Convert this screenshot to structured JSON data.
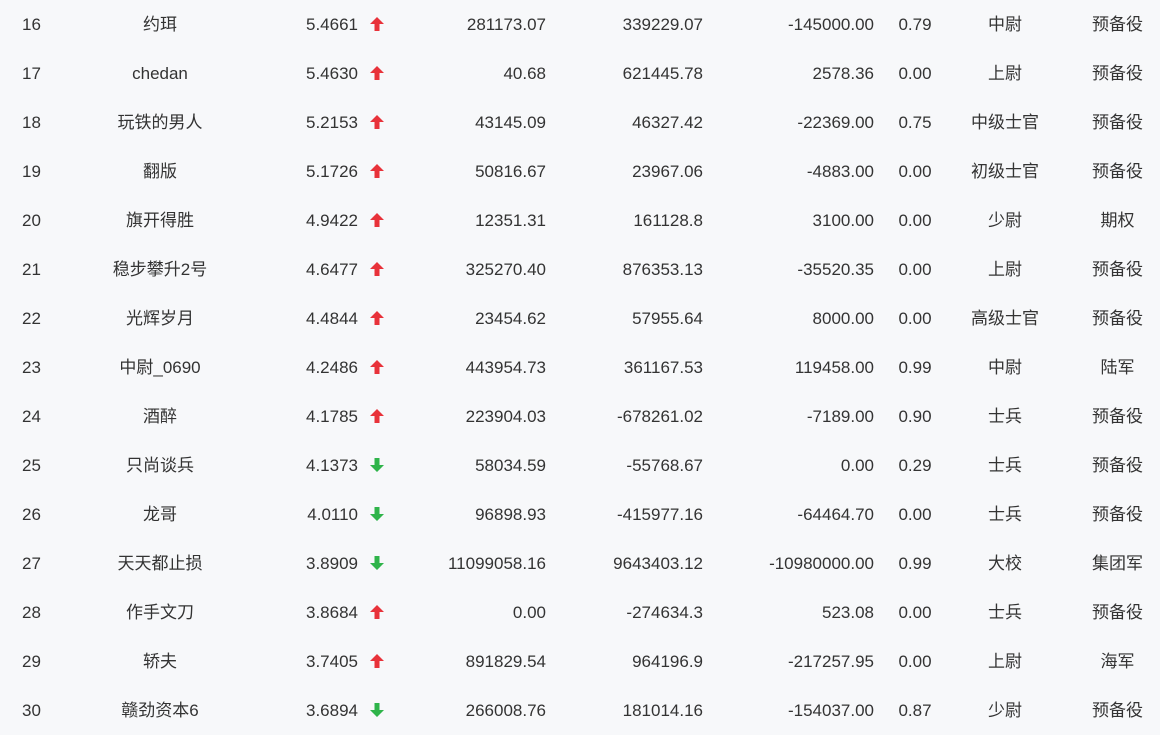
{
  "colors": {
    "up": "#e8323a",
    "down": "#2fb44a",
    "text": "#333333",
    "background": "#f7f8fa"
  },
  "rows": [
    {
      "rank": "16",
      "name": "约珥",
      "score": "5.4661",
      "trend": "up",
      "v1": "281173.07",
      "v2": "339229.07",
      "v3": "-145000.00",
      "ratio": "0.79",
      "level": "中尉",
      "type": "预备役"
    },
    {
      "rank": "17",
      "name": "chedan",
      "score": "5.4630",
      "trend": "up",
      "v1": "40.68",
      "v2": "621445.78",
      "v3": "2578.36",
      "ratio": "0.00",
      "level": "上尉",
      "type": "预备役"
    },
    {
      "rank": "18",
      "name": "玩铁的男人",
      "score": "5.2153",
      "trend": "up",
      "v1": "43145.09",
      "v2": "46327.42",
      "v3": "-22369.00",
      "ratio": "0.75",
      "level": "中级士官",
      "type": "预备役"
    },
    {
      "rank": "19",
      "name": "翻版",
      "score": "5.1726",
      "trend": "up",
      "v1": "50816.67",
      "v2": "23967.06",
      "v3": "-4883.00",
      "ratio": "0.00",
      "level": "初级士官",
      "type": "预备役"
    },
    {
      "rank": "20",
      "name": "旗开得胜",
      "score": "4.9422",
      "trend": "up",
      "v1": "12351.31",
      "v2": "161128.8",
      "v3": "3100.00",
      "ratio": "0.00",
      "level": "少尉",
      "type": "期权"
    },
    {
      "rank": "21",
      "name": "稳步攀升2号",
      "score": "4.6477",
      "trend": "up",
      "v1": "325270.40",
      "v2": "876353.13",
      "v3": "-35520.35",
      "ratio": "0.00",
      "level": "上尉",
      "type": "预备役"
    },
    {
      "rank": "22",
      "name": "光辉岁月",
      "score": "4.4844",
      "trend": "up",
      "v1": "23454.62",
      "v2": "57955.64",
      "v3": "8000.00",
      "ratio": "0.00",
      "level": "高级士官",
      "type": "预备役"
    },
    {
      "rank": "23",
      "name": "中尉_0690",
      "score": "4.2486",
      "trend": "up",
      "v1": "443954.73",
      "v2": "361167.53",
      "v3": "119458.00",
      "ratio": "0.99",
      "level": "中尉",
      "type": "陆军"
    },
    {
      "rank": "24",
      "name": "酒醉",
      "score": "4.1785",
      "trend": "up",
      "v1": "223904.03",
      "v2": "-678261.02",
      "v3": "-7189.00",
      "ratio": "0.90",
      "level": "士兵",
      "type": "预备役"
    },
    {
      "rank": "25",
      "name": "只尚谈兵",
      "score": "4.1373",
      "trend": "down",
      "v1": "58034.59",
      "v2": "-55768.67",
      "v3": "0.00",
      "ratio": "0.29",
      "level": "士兵",
      "type": "预备役"
    },
    {
      "rank": "26",
      "name": "龙哥",
      "score": "4.0110",
      "trend": "down",
      "v1": "96898.93",
      "v2": "-415977.16",
      "v3": "-64464.70",
      "ratio": "0.00",
      "level": "士兵",
      "type": "预备役"
    },
    {
      "rank": "27",
      "name": "天天都止损",
      "score": "3.8909",
      "trend": "down",
      "v1": "11099058.16",
      "v2": "9643403.12",
      "v3": "-10980000.00",
      "ratio": "0.99",
      "level": "大校",
      "type": "集团军"
    },
    {
      "rank": "28",
      "name": "作手文刀",
      "score": "3.8684",
      "trend": "up",
      "v1": "0.00",
      "v2": "-274634.3",
      "v3": "523.08",
      "ratio": "0.00",
      "level": "士兵",
      "type": "预备役"
    },
    {
      "rank": "29",
      "name": "轿夫",
      "score": "3.7405",
      "trend": "up",
      "v1": "891829.54",
      "v2": "964196.9",
      "v3": "-217257.95",
      "ratio": "0.00",
      "level": "上尉",
      "type": "海军"
    },
    {
      "rank": "30",
      "name": "赣劲资本6",
      "score": "3.6894",
      "trend": "down",
      "v1": "266008.76",
      "v2": "181014.16",
      "v3": "-154037.00",
      "ratio": "0.87",
      "level": "少尉",
      "type": "预备役"
    }
  ]
}
